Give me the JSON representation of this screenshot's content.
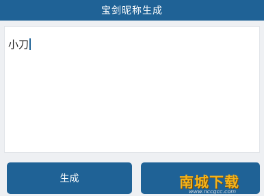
{
  "header": {
    "title": "宝剑昵称生成"
  },
  "input": {
    "value": "小刀"
  },
  "actions": {
    "generate_label": "生成",
    "second_label": ""
  },
  "watermark": {
    "logo_text": "南城下载",
    "url_text": "www.nccgcc.com"
  },
  "colors": {
    "accent": "#1f6296",
    "background": "#eef0f3",
    "panel": "#ffffff"
  }
}
